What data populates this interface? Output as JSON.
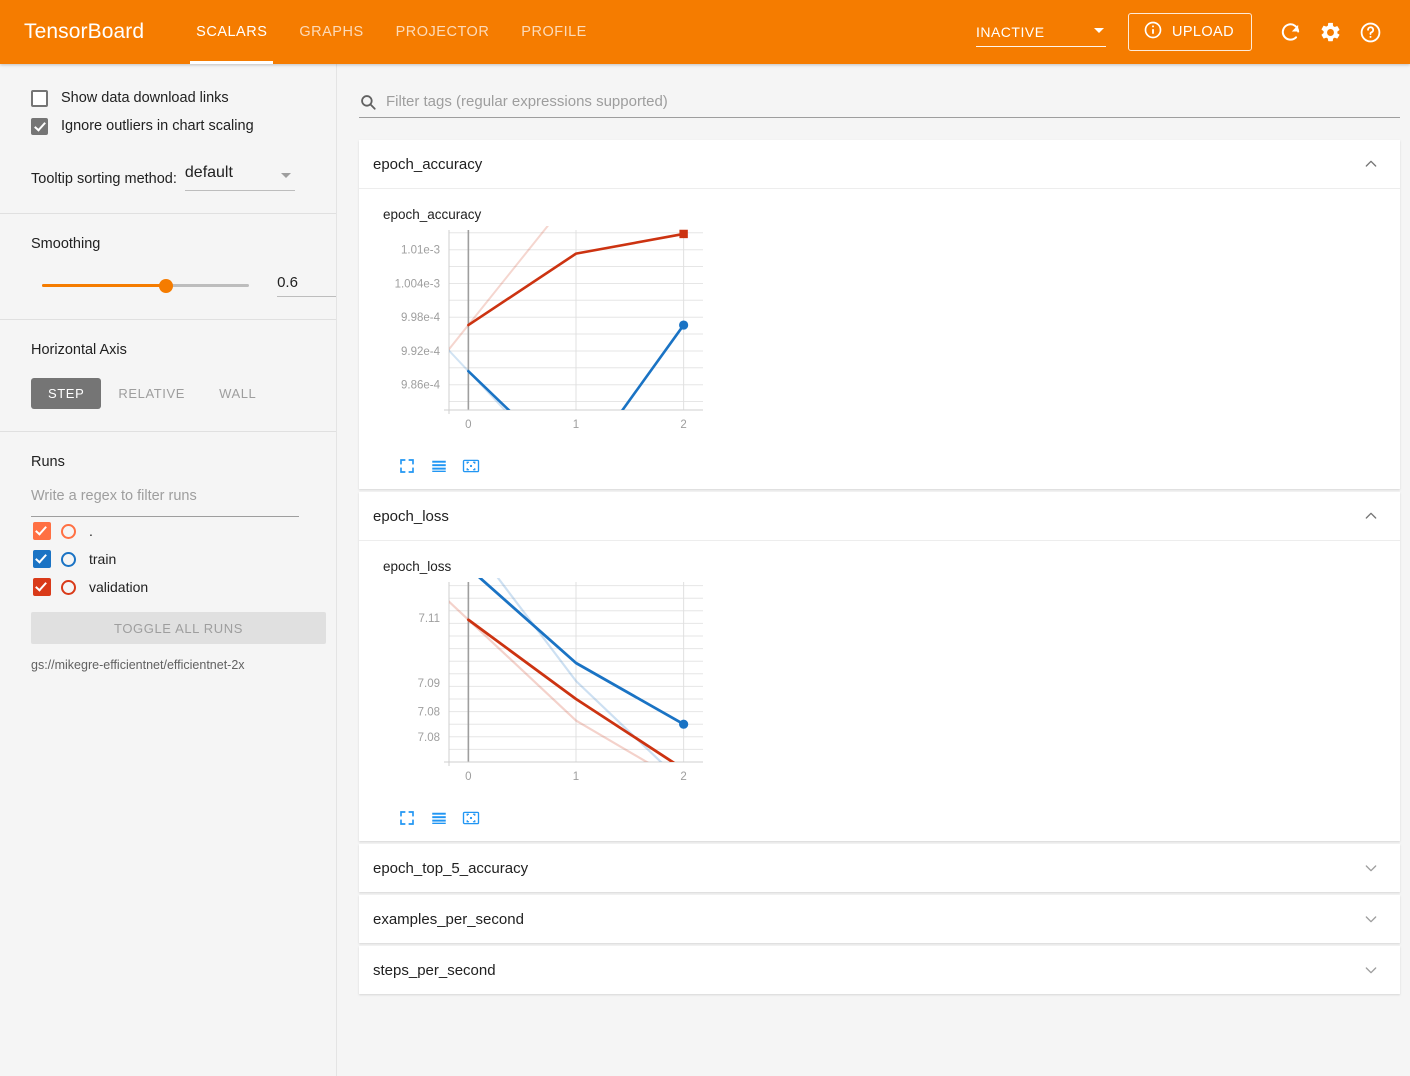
{
  "app": {
    "brand": "TensorBoard",
    "accent_color": "#f57c00",
    "background_color": "#f5f5f5"
  },
  "topbar": {
    "tabs": [
      {
        "label": "SCALARS",
        "active": true
      },
      {
        "label": "GRAPHS",
        "active": false
      },
      {
        "label": "PROJECTOR",
        "active": false
      },
      {
        "label": "PROFILE",
        "active": false
      }
    ],
    "status_select": {
      "value": "INACTIVE",
      "icon": "chevron-down-icon"
    },
    "upload_button": {
      "label": "UPLOAD",
      "icon": "info-circle-icon"
    },
    "reload_icon": "reload-icon",
    "settings_icon": "gear-icon",
    "help_icon": "help-circle-icon"
  },
  "sidebar": {
    "checkboxes": [
      {
        "label": "Show data download links",
        "checked": false
      },
      {
        "label": "Ignore outliers in chart scaling",
        "checked": true
      }
    ],
    "tooltip_sorting": {
      "label": "Tooltip sorting method:",
      "value": "default"
    },
    "smoothing": {
      "label": "Smoothing",
      "value": "0.6",
      "fraction": 0.6
    },
    "horizontal_axis": {
      "label": "Horizontal Axis",
      "options": [
        {
          "label": "STEP",
          "active": true
        },
        {
          "label": "RELATIVE",
          "active": false
        },
        {
          "label": "WALL",
          "active": false
        }
      ]
    },
    "runs": {
      "label": "Runs",
      "filter_placeholder": "Write a regex to filter runs",
      "items": [
        {
          "label": ".",
          "checked": true,
          "color": "#ff7043"
        },
        {
          "label": "train",
          "checked": true,
          "color": "#1a73c4"
        },
        {
          "label": "validation",
          "checked": true,
          "color": "#d32f2f"
        }
      ],
      "toggle_all_label": "TOGGLE ALL RUNS",
      "logdir": "gs://mikegre-efficientnet/efficientnet-2x"
    }
  },
  "main": {
    "filter": {
      "placeholder": "Filter tags (regular expressions supported)",
      "icon": "search-icon",
      "value": ""
    },
    "cards": [
      {
        "title": "epoch_accuracy",
        "expanded": true,
        "chevron": "chevron-up-icon"
      },
      {
        "title": "epoch_loss",
        "expanded": true,
        "chevron": "chevron-up-icon"
      },
      {
        "title": "epoch_top_5_accuracy",
        "expanded": false,
        "chevron": "chevron-down-icon"
      },
      {
        "title": "examples_per_second",
        "expanded": false,
        "chevron": "chevron-down-icon"
      },
      {
        "title": "steps_per_second",
        "expanded": false,
        "chevron": "chevron-down-icon"
      }
    ],
    "chart_tools": [
      {
        "name": "expand-chart-icon",
        "label": "expand"
      },
      {
        "name": "data-series-icon",
        "label": "toggle-series"
      },
      {
        "name": "fit-domain-icon",
        "label": "fit"
      }
    ]
  },
  "chart_data": [
    {
      "type": "line",
      "title": "epoch_accuracy",
      "xlabel": "",
      "ylabel": "",
      "x": [
        0,
        1,
        2
      ],
      "xticks": [
        "0",
        "1",
        "2"
      ],
      "xlim": [
        -0.18,
        2.18
      ],
      "yticks": [
        "9.86e-4",
        "9.92e-4",
        "9.98e-4",
        "1.004e-3",
        "1.01e-3"
      ],
      "ytickvalues": [
        0.000986,
        0.000992,
        0.000998,
        0.001004,
        0.00101
      ],
      "ylim": [
        0.0009815,
        0.0010135
      ],
      "grid": true,
      "legend": "none",
      "series": [
        {
          "name": "validation-smoothed",
          "color": "#cc3311",
          "opacity": 1,
          "width": 2.6,
          "values": [
            0.0009966,
            0.0010093,
            0.0010128
          ]
        },
        {
          "name": "validation-raw",
          "color": "#cc3311",
          "opacity": 0.2,
          "width": 2.0,
          "values": [
            0.0009966,
            0.0010205,
            0.0010205
          ]
        },
        {
          "name": "train-smoothed",
          "color": "#1a73c4",
          "opacity": 1,
          "width": 2.6,
          "values": [
            0.0009884,
            0.00097,
            0.0009966
          ]
        },
        {
          "name": "train-raw",
          "color": "#1a73c4",
          "opacity": 0.2,
          "width": 2.0,
          "values": [
            0.0009884,
            0.000968,
            0.000968
          ]
        }
      ],
      "endpoint_markers": [
        {
          "series": "validation-smoothed",
          "x": 2,
          "y": 0.0010128,
          "shape": "square",
          "color": "#cc3311"
        },
        {
          "series": "train-smoothed",
          "x": 2,
          "y": 0.0009966,
          "shape": "circle",
          "color": "#1a73c4"
        }
      ]
    },
    {
      "type": "line",
      "title": "epoch_loss",
      "xlabel": "",
      "ylabel": "",
      "x": [
        0,
        1,
        2
      ],
      "xticks": [
        "0",
        "1",
        "2"
      ],
      "xlim": [
        -0.18,
        2.18
      ],
      "yticks": [
        "7.08",
        "7.08",
        "7.09",
        "7.11"
      ],
      "ytickvalues": [
        7.075,
        7.082,
        7.09,
        7.108
      ],
      "ylim": [
        7.068,
        7.118
      ],
      "grid": true,
      "legend": "none",
      "series": [
        {
          "name": "train-smoothed",
          "color": "#1a73c4",
          "opacity": 1,
          "width": 2.8,
          "values": [
            7.122,
            7.0955,
            7.0785
          ]
        },
        {
          "name": "train-raw",
          "color": "#1a73c4",
          "opacity": 0.22,
          "width": 2.2,
          "values": [
            7.13,
            7.0905,
            7.062
          ]
        },
        {
          "name": "validation-smoothed",
          "color": "#cc3311",
          "opacity": 1,
          "width": 2.8,
          "values": [
            7.1075,
            7.0855,
            7.066
          ]
        },
        {
          "name": "validation-raw",
          "color": "#cc3311",
          "opacity": 0.22,
          "width": 2.2,
          "values": [
            7.1075,
            7.0795,
            7.062
          ]
        }
      ],
      "endpoint_markers": [
        {
          "series": "train-smoothed",
          "x": 2,
          "y": 7.0785,
          "shape": "circle",
          "color": "#1a73c4"
        }
      ]
    }
  ]
}
